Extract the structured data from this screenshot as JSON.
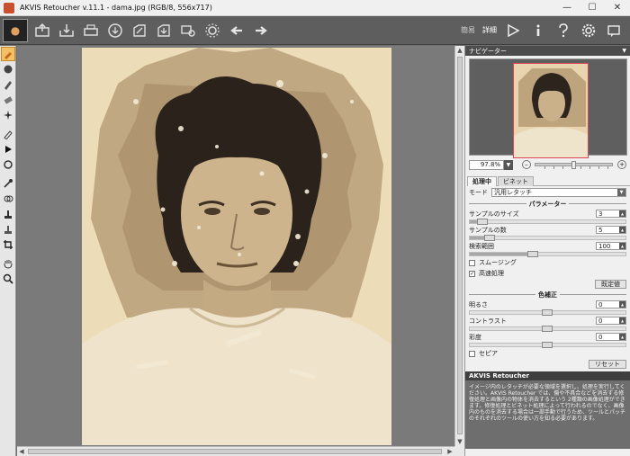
{
  "window": {
    "title": "AKVIS Retoucher v.11.1 - dama.jpg (RGB/8, 556x717)"
  },
  "toolbar": {
    "mode_simple": "簡易",
    "mode_detail": "詳細"
  },
  "navigator": {
    "header": "ナビゲーター",
    "zoom": "97.8%"
  },
  "tabs": [
    {
      "label": "処理中"
    },
    {
      "label": "ビネット"
    }
  ],
  "settings": {
    "mode_label": "モード",
    "mode_value": "汎用レタッチ",
    "params_section": "パラメーター",
    "sample_size_label": "サンプルのサイズ",
    "sample_size_value": "3",
    "sample_count_label": "サンプルの数",
    "sample_count_value": "5",
    "search_range_label": "検索範囲",
    "search_range_value": "100",
    "smoothing_label": "スムージング",
    "smoothing_checked": false,
    "fast_label": "高速処理",
    "fast_checked": true,
    "default_button": "既定値",
    "color_section": "色補正",
    "brightness_label": "明るさ",
    "brightness_value": "0",
    "contrast_label": "コントラスト",
    "contrast_value": "0",
    "saturation_label": "彩度",
    "saturation_value": "0",
    "sepia_label": "セピア",
    "sepia_checked": false,
    "reset_button": "リセット"
  },
  "help": {
    "title": "AKVIS Retoucher",
    "text": "イメージ内のレタッチが必要な領域を選択し、処理を実行してください。AKVIS Retoucher では、傷や不具合などを消去する修復処理と画像内の物体を消去するという 2種類の画像処理ができます。修復処理とビネット処理によって行われるのでなく、画像内のものを消去する場合は一部手動で行うため、ツールとパッチのそれぞれのツールの使い方を知る必要があります。"
  }
}
